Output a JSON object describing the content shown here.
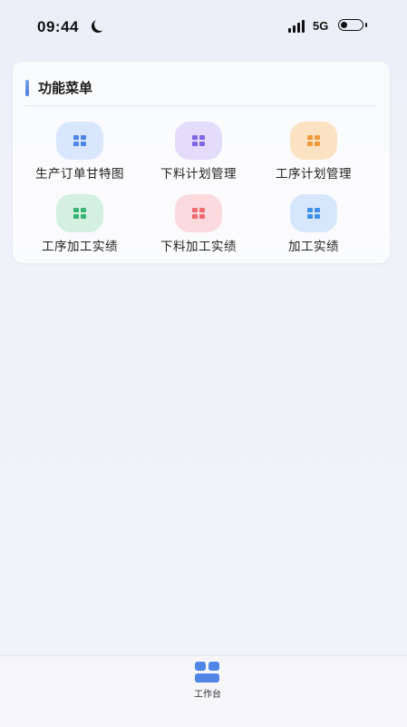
{
  "status_bar": {
    "time": "09:44",
    "network": "5G"
  },
  "menu": {
    "title": "功能菜单",
    "items": [
      {
        "label": "生产订单甘特图",
        "icon": "grid-icon",
        "tile_color": "#d9e6fb",
        "icon_color": "#4d86e8"
      },
      {
        "label": "下料计划管理",
        "icon": "grid-icon",
        "tile_color": "#e3dcfa",
        "icon_color": "#7f66e6"
      },
      {
        "label": "工序计划管理",
        "icon": "grid-icon",
        "tile_color": "#fbe2c2",
        "icon_color": "#f19a3b"
      },
      {
        "label": "工序加工实绩",
        "icon": "grid-icon",
        "tile_color": "#d4f0e1",
        "icon_color": "#36b375"
      },
      {
        "label": "下料加工实绩",
        "icon": "grid-icon",
        "tile_color": "#fadadd",
        "icon_color": "#ef6a6f"
      },
      {
        "label": "加工实绩",
        "icon": "grid-icon",
        "tile_color": "#d6e7fb",
        "icon_color": "#3e8fe8"
      }
    ]
  },
  "bottom_nav": {
    "items": [
      {
        "label": "工作台",
        "icon": "workbench-icon",
        "active": true
      }
    ]
  },
  "colors": {
    "accent": "#4f86e6",
    "background": "#f0f1f8"
  }
}
